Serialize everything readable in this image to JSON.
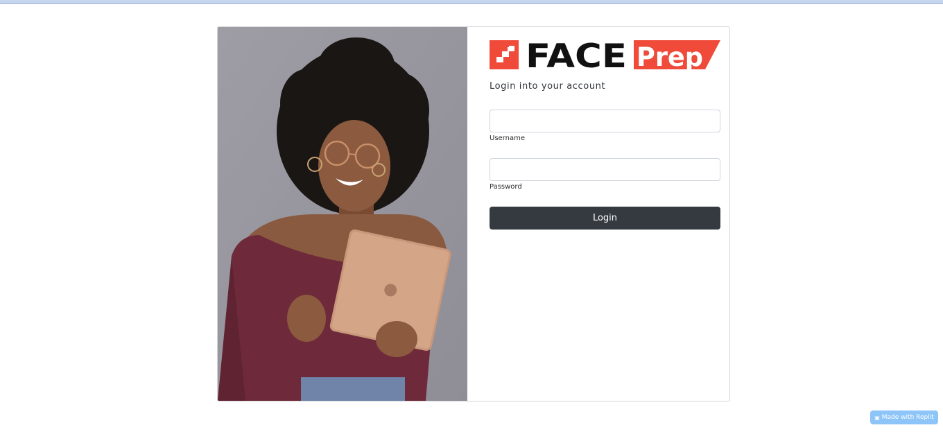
{
  "brand": {
    "name_part1": "FACE",
    "name_part2": "Prep",
    "accent_color": "#ef4a3a",
    "text_color": "#111111"
  },
  "login": {
    "subtitle": "Login into your account",
    "username": {
      "label": "Username",
      "value": "",
      "placeholder": ""
    },
    "password": {
      "label": "Password",
      "value": "",
      "placeholder": ""
    },
    "submit_label": "Login"
  },
  "hero_image": {
    "description_icon": "woman-with-tablet-photo"
  },
  "badge": {
    "label": "Made with Replit",
    "icon": "replit-icon"
  }
}
